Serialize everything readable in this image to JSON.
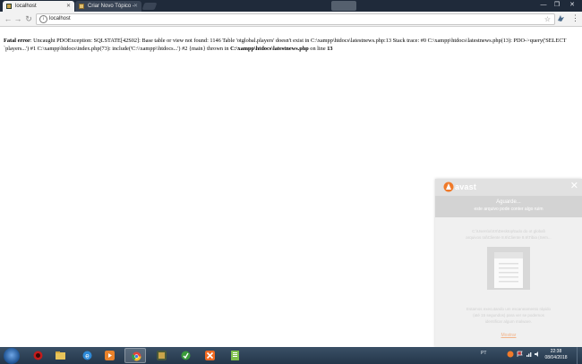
{
  "browser": {
    "tabs": [
      {
        "label": "localhost",
        "active": true
      },
      {
        "label": "Criar Novo Tópico - ",
        "active": false
      }
    ],
    "url": "localhost"
  },
  "page": {
    "error_label": "Fatal error",
    "error_text_1": ": Uncaught PDOException: SQLSTATE[42S02]: Base table or view not found: 1146 Table 'otglobal.players' doesn't exist in C:\\xampp\\htdocs\\latestnews.php:13 Stack trace: #0 C:\\xampp\\htdocs\\latestnews.php(13): PDO->query('SELECT `players...') #1 C:\\xampp\\htdocs\\index.php(73): include('C:\\\\xampp\\\\htdocs...') #2 {main} thrown in ",
    "error_file": "C:\\xampp\\htdocs\\latestnews.php",
    "error_on_line": " on line ",
    "error_line": "13"
  },
  "avast": {
    "brand": "avast",
    "status_title": "Aguarde...",
    "status_subtitle": "este arquivo pode conter algo ruim",
    "path_line1": "C:\\Users\\x\\XX\\Desktop\\tudo do ot global\\",
    "path_line2": "arquivos ral\\Cliente 8.6\\Cliente 8.6\\Tibia (Sem...",
    "scan_line1": "Estamos executando um escaneamento rápido",
    "scan_line2": "(até 15 segundos) para ver se podemos",
    "scan_line3": "identificar algum malware.",
    "link": "Mostrar"
  },
  "taskbar": {
    "language": "PT",
    "time": "22:38",
    "date": "08/04/2018"
  },
  "colors": {
    "chrome_dark": "#1f2a3a",
    "avast_orange": "#f07a2a",
    "taskbar": "#2b3e52"
  }
}
